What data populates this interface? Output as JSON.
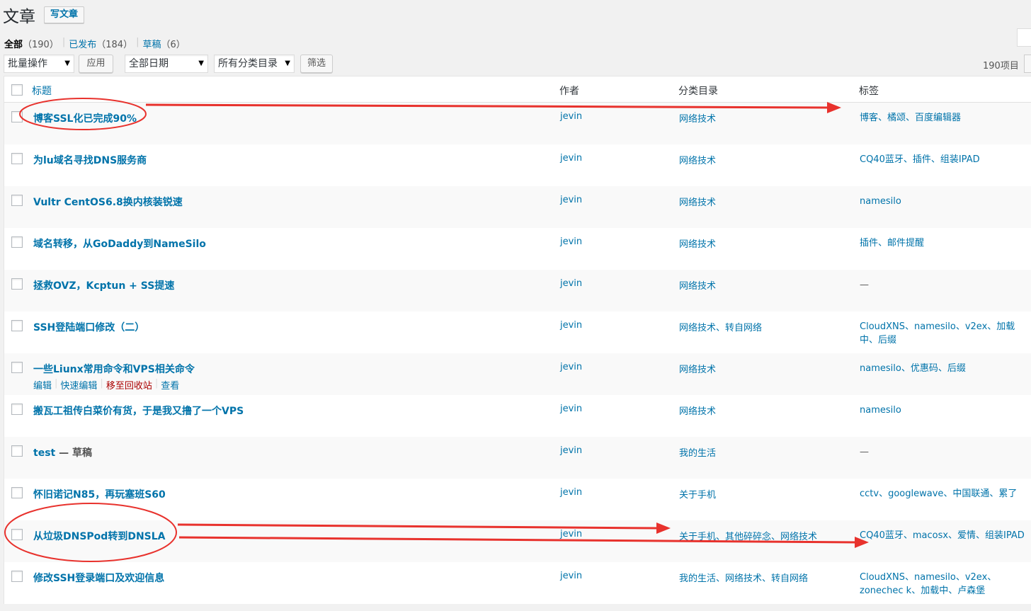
{
  "header": {
    "title": "文章",
    "add_new": "写文章"
  },
  "views": {
    "all": {
      "label": "全部",
      "count": "（190）"
    },
    "published": {
      "label": "已发布",
      "count": "（184）"
    },
    "drafts": {
      "label": "草稿",
      "count": "（6）"
    },
    "sep": "|"
  },
  "filters": {
    "bulk_action": "批量操作",
    "apply": "应用",
    "dates": "全部日期",
    "categories": "所有分类目录",
    "filter": "筛选",
    "items_count": "190项目"
  },
  "table": {
    "columns": {
      "title": "标题",
      "author": "作者",
      "categories": "分类目录",
      "tags": "标签"
    },
    "rows": [
      {
        "title": "博客SSL化已完成90%",
        "state": "",
        "author": "jevin",
        "categories": "网络技术",
        "tags": "博客、橘颂、百度编辑器"
      },
      {
        "title": "为lu域名寻找DNS服务商",
        "state": "",
        "author": "jevin",
        "categories": "网络技术",
        "tags": "CQ40蓝牙、插件、组装IPAD"
      },
      {
        "title": "Vultr CentOS6.8换内核装锐速",
        "state": "",
        "author": "jevin",
        "categories": "网络技术",
        "tags": "namesilo"
      },
      {
        "title": "域名转移，从GoDaddy到NameSilo",
        "state": "",
        "author": "jevin",
        "categories": "网络技术",
        "tags": "插件、邮件提醒"
      },
      {
        "title": "拯救OVZ，Kcptun + SS提速",
        "state": "",
        "author": "jevin",
        "categories": "网络技术",
        "tags": "—"
      },
      {
        "title": "SSH登陆端口修改（二）",
        "state": "",
        "author": "jevin",
        "categories": "网络技术、转自网络",
        "tags": "CloudXNS、namesilo、v2ex、加载中、后缀"
      },
      {
        "title": "一些Liunx常用命令和VPS相关命令",
        "state": "",
        "author": "jevin",
        "categories": "网络技术",
        "tags": "namesilo、优惠码、后缀"
      },
      {
        "title": "搬瓦工祖传白菜价有货，于是我又撸了一个VPS",
        "state": "",
        "author": "jevin",
        "categories": "网络技术",
        "tags": "namesilo"
      },
      {
        "title": "test",
        "state": " — 草稿",
        "author": "jevin",
        "categories": "我的生活",
        "tags": "—"
      },
      {
        "title": "怀旧诺记N85，再玩塞班S60",
        "state": "",
        "author": "jevin",
        "categories": "关于手机",
        "tags": "cctv、googlewave、中国联通、累了"
      },
      {
        "title": "从垃圾DNSPod转到DNSLA",
        "state": "",
        "author": "jevin",
        "categories": "关于手机、其他碎碎念、网络技术",
        "tags": "CQ40蓝牙、macosx、爱情、组装IPAD"
      },
      {
        "title": "修改SSH登录端口及欢迎信息",
        "state": "",
        "author": "jevin",
        "categories": "我的生活、网络技术、转自网络",
        "tags": "CloudXNS、namesilo、v2ex、zonechec k、加载中、卢森堡"
      }
    ],
    "row_actions": {
      "edit": "编辑",
      "quick_edit": "快速编辑",
      "trash": "移至回收站",
      "view": "查看",
      "sep": "|"
    }
  },
  "colors": {
    "link": "#0073aa",
    "trash": "#aa0000",
    "annotation": "#e8322d"
  }
}
